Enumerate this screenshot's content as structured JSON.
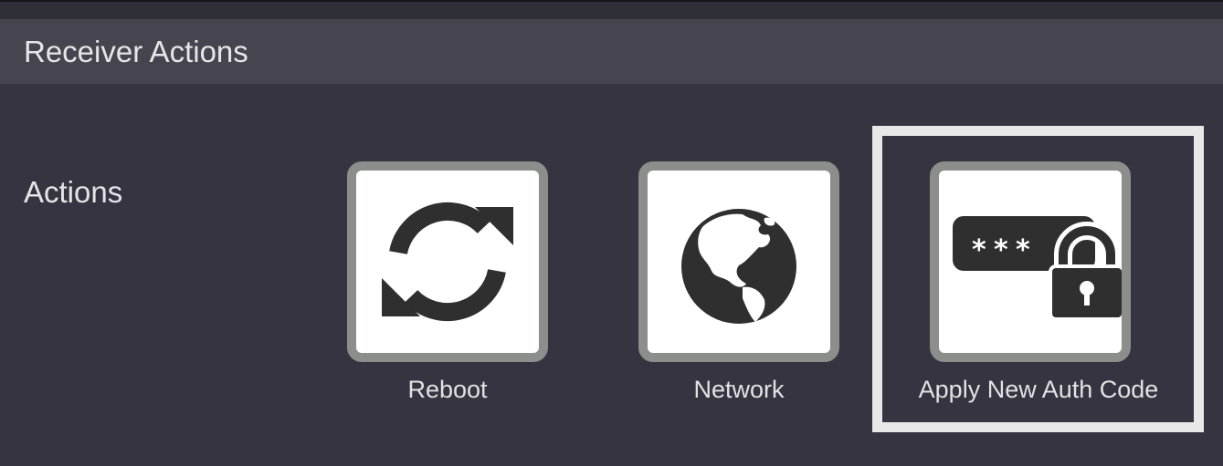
{
  "header": {
    "title": "Receiver Actions"
  },
  "section": {
    "label": "Actions"
  },
  "actions": [
    {
      "label": "Reboot",
      "icon": "reboot-icon"
    },
    {
      "label": "Network",
      "icon": "globe-icon"
    },
    {
      "label": "Apply New Auth Code",
      "icon": "auth-code-lock-icon",
      "highlighted": true
    }
  ],
  "colors": {
    "background": "#353440",
    "header": "#45444f",
    "tile_border": "#8b8e8a",
    "icon": "#2f2f2f",
    "highlight": "#e8e8e8"
  }
}
